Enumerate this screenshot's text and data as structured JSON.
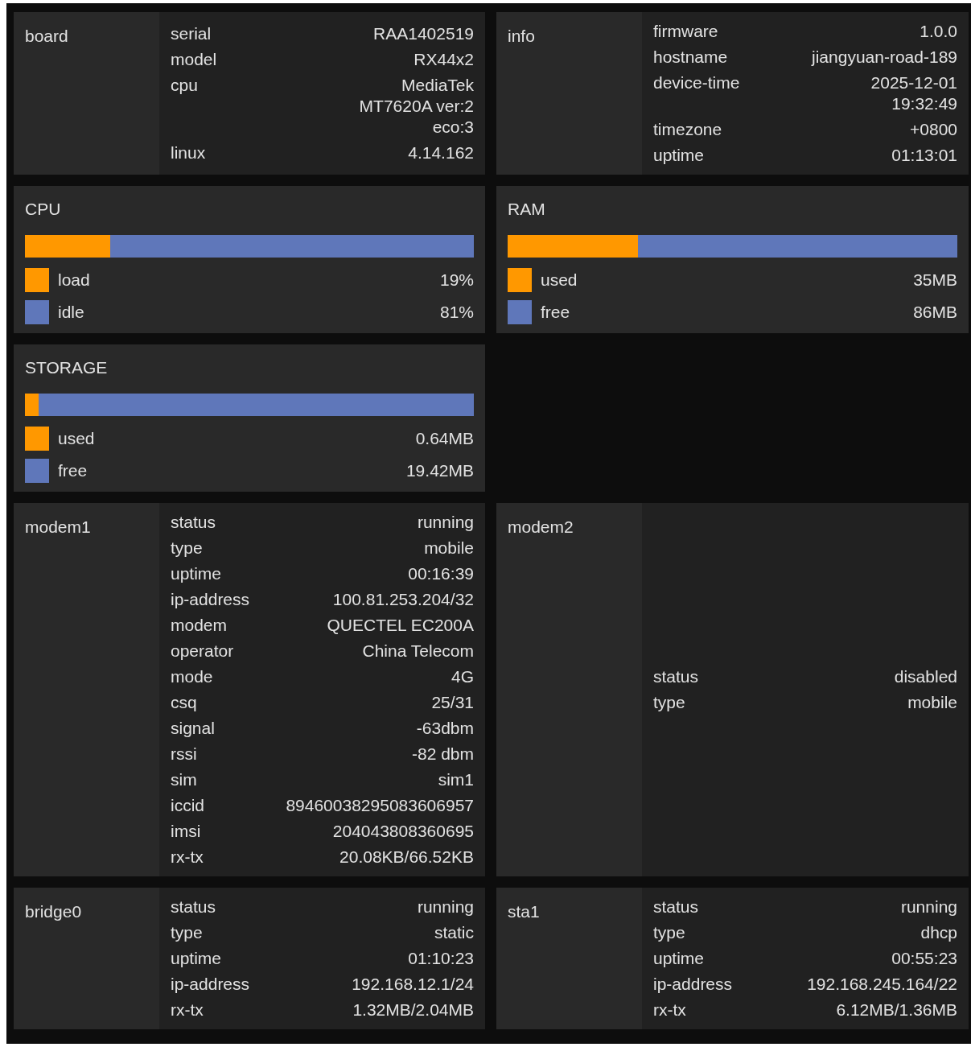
{
  "cards": [
    {
      "kind": "info",
      "label": "board",
      "rows": [
        {
          "key": "serial",
          "value": [
            "RAA1402519"
          ]
        },
        {
          "key": "model",
          "value": [
            "RX44x2"
          ]
        },
        {
          "key": "cpu",
          "value": [
            "MediaTek",
            "MT7620A ver:2",
            "eco:3"
          ]
        },
        {
          "key": "linux",
          "value": [
            "4.14.162"
          ]
        }
      ]
    },
    {
      "kind": "info",
      "label": "info",
      "rows": [
        {
          "key": "firmware",
          "value": [
            "1.0.0"
          ]
        },
        {
          "key": "hostname",
          "value": [
            "jiangyuan-road-189"
          ]
        },
        {
          "key": "device-time",
          "value": [
            "2025-12-01",
            "19:32:49"
          ]
        },
        {
          "key": "timezone",
          "value": [
            "+0800"
          ]
        },
        {
          "key": "uptime",
          "value": [
            "01:13:01"
          ]
        }
      ]
    },
    {
      "kind": "usage",
      "title": "CPU",
      "items": [
        {
          "name": "load",
          "value": "19%",
          "level": 0.19,
          "color": "#ff9800"
        },
        {
          "name": "idle",
          "value": "81%",
          "color": "#5f77ba"
        }
      ]
    },
    {
      "kind": "usage",
      "title": "RAM",
      "items": [
        {
          "name": "used",
          "value": "35MB",
          "level": 0.29,
          "color": "#ff9800"
        },
        {
          "name": "free",
          "value": "86MB",
          "color": "#5f77ba"
        }
      ]
    },
    {
      "kind": "usage",
      "title": "STORAGE",
      "items": [
        {
          "name": "used",
          "value": "0.64MB",
          "level": 0.03,
          "color": "#ff9800"
        },
        {
          "name": "free",
          "value": "19.42MB",
          "color": "#5f77ba"
        }
      ]
    },
    {
      "kind": "empty"
    },
    {
      "kind": "info",
      "label": "modem1",
      "rows": [
        {
          "key": "status",
          "value": [
            "running"
          ]
        },
        {
          "key": "type",
          "value": [
            "mobile"
          ]
        },
        {
          "key": "uptime",
          "value": [
            "00:16:39"
          ]
        },
        {
          "key": "ip-address",
          "value": [
            "100.81.253.204/32"
          ]
        },
        {
          "key": "modem",
          "value": [
            "QUECTEL EC200A"
          ]
        },
        {
          "key": "operator",
          "value": [
            "China Telecom"
          ]
        },
        {
          "key": "mode",
          "value": [
            "4G"
          ]
        },
        {
          "key": "csq",
          "value": [
            "25/31"
          ]
        },
        {
          "key": "signal",
          "value": [
            "-63dbm"
          ]
        },
        {
          "key": "rssi",
          "value": [
            "-82 dbm"
          ]
        },
        {
          "key": "sim",
          "value": [
            "sim1"
          ]
        },
        {
          "key": "iccid",
          "value": [
            "89460038295083606957"
          ]
        },
        {
          "key": "imsi",
          "value": [
            "204043808360695"
          ]
        },
        {
          "key": "rx-tx",
          "value": [
            "20.08KB/66.52KB"
          ]
        }
      ]
    },
    {
      "kind": "info",
      "label": "modem2",
      "rows": [
        {
          "key": "status",
          "value": [
            "disabled"
          ]
        },
        {
          "key": "type",
          "value": [
            "mobile"
          ]
        }
      ]
    },
    {
      "kind": "info",
      "label": "bridge0",
      "rows": [
        {
          "key": "status",
          "value": [
            "running"
          ]
        },
        {
          "key": "type",
          "value": [
            "static"
          ]
        },
        {
          "key": "uptime",
          "value": [
            "01:10:23"
          ]
        },
        {
          "key": "ip-address",
          "value": [
            "192.168.12.1/24"
          ]
        },
        {
          "key": "rx-tx",
          "value": [
            "1.32MB/2.04MB"
          ]
        }
      ]
    },
    {
      "kind": "info",
      "label": "sta1",
      "rows": [
        {
          "key": "status",
          "value": [
            "running"
          ]
        },
        {
          "key": "type",
          "value": [
            "dhcp"
          ]
        },
        {
          "key": "uptime",
          "value": [
            "00:55:23"
          ]
        },
        {
          "key": "ip-address",
          "value": [
            "192.168.245.164/22"
          ]
        },
        {
          "key": "rx-tx",
          "value": [
            "6.12MB/1.36MB"
          ]
        }
      ]
    }
  ]
}
